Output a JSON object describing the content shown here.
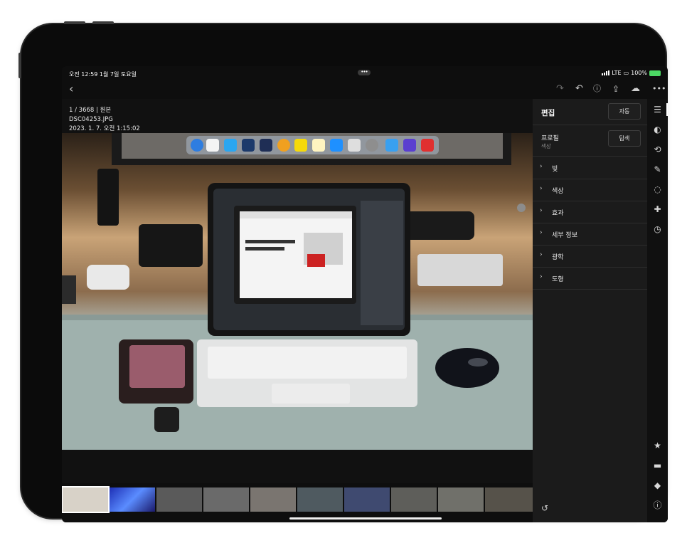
{
  "status_bar": {
    "time": "오전 12:59",
    "date": "1월 7일 토요일",
    "network": "LTE",
    "battery": "100%",
    "multitask_dots": "•••"
  },
  "toolbar": {
    "back_icon": "chevron-left-icon",
    "redo_icon": "redo-icon",
    "undo_icon": "undo-icon",
    "help_icon": "help-icon",
    "share_icon": "share-icon",
    "cloud_icon": "cloud-sync-icon",
    "more_icon": "more-icon"
  },
  "photo_info": {
    "index": "1 / 3668 | 원본",
    "filename": "DSC04253.JPG",
    "datetime": "2023. 1. 7. 오전 1:15:02"
  },
  "edit_panel": {
    "title": "편집",
    "auto_label": "자동",
    "profile_label": "프로필",
    "profile_value": "색상",
    "browse_label": "탐색",
    "sections": [
      "빛",
      "색상",
      "효과",
      "세부 정보",
      "광학",
      "도형"
    ]
  },
  "right_rail": {
    "icons": [
      "sliders-icon",
      "presets-icon",
      "crop-icon",
      "brush-icon",
      "mask-icon",
      "heal-icon",
      "history-icon",
      "star-icon",
      "comment-icon",
      "tag-icon",
      "info-icon"
    ]
  },
  "reset_icon": "reset-icon",
  "colors": {
    "app_bg": "#111111",
    "panel_bg": "#1b1b1b",
    "accent_green": "#4cd964",
    "text_primary": "#ffffff"
  }
}
